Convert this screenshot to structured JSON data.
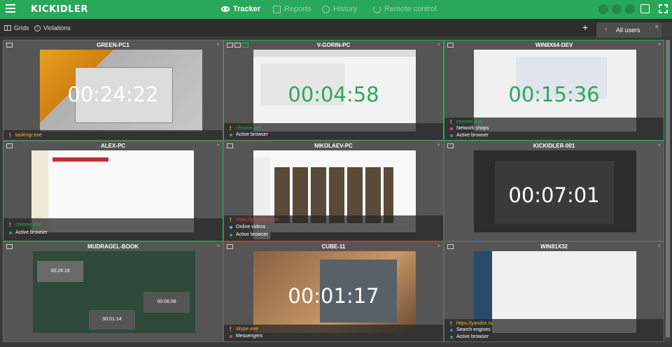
{
  "app": {
    "logo": "KICKIDLER"
  },
  "nav": [
    {
      "label": "Tracker",
      "active": true,
      "icon": "eye-icon"
    },
    {
      "label": "Reports",
      "active": false,
      "icon": "report-icon"
    },
    {
      "label": "History",
      "active": false,
      "icon": "history-icon"
    },
    {
      "label": "Remote control",
      "active": false,
      "icon": "remote-icon"
    }
  ],
  "subbar": {
    "grids": "Grids",
    "violations": "Violations",
    "add": "+",
    "user_tab": "All users",
    "close": "×"
  },
  "tiles": [
    {
      "name": "GREEN-PC1",
      "timer": "00:24:22",
      "timer_color": "white",
      "border": "none",
      "rows": [
        {
          "type": "excl",
          "text": "taskmgr.exe",
          "cls": "app-y"
        }
      ]
    },
    {
      "name": "V-GORIN-PC",
      "timer": "00:04:58",
      "timer_color": "green",
      "border": "green",
      "rows": [
        {
          "type": "excl",
          "text": "chrome.exe",
          "cls": "app-g"
        },
        {
          "type": "dot",
          "color": "#2aa85a",
          "text": "Active browser"
        }
      ]
    },
    {
      "name": "WIN8X64-DEV",
      "timer": "00:15:36",
      "timer_color": "green",
      "border": "green",
      "rows": [
        {
          "type": "excl",
          "text": "chrome.exe",
          "cls": "app-g"
        },
        {
          "type": "dot",
          "color": "#d04090",
          "text": "Network shops"
        },
        {
          "type": "dot",
          "color": "#2aa85a",
          "text": "Active browser"
        }
      ]
    },
    {
      "name": "ALEX-PC",
      "timer": "",
      "timer_color": "white",
      "border": "green",
      "rows": [
        {
          "type": "excl",
          "text": "chrome.exe",
          "cls": "app-g"
        },
        {
          "type": "dot",
          "color": "#2aa85a",
          "text": "Active browser"
        }
      ]
    },
    {
      "name": "NIKOLAEV-PC",
      "timer": "",
      "timer_color": "white",
      "border": "red",
      "rows": [
        {
          "type": "excl",
          "text": "https://youtube.com",
          "cls": "app-r"
        },
        {
          "type": "dot",
          "color": "#40c0e0",
          "text": "Online videos"
        },
        {
          "type": "dot",
          "color": "#2aa85a",
          "text": "Active browser"
        }
      ]
    },
    {
      "name": "KICKIDLER-001",
      "timer": "00:07:01",
      "timer_color": "white",
      "border": "none",
      "rows": []
    },
    {
      "name": "MUDRAGEL-BOOK",
      "timer": "",
      "timer_color": "white",
      "border": "none",
      "rows": []
    },
    {
      "name": "CUBE-11",
      "timer": "00:01:17",
      "timer_color": "white",
      "border": "none",
      "rows": [
        {
          "type": "excl",
          "text": "skype.exe",
          "cls": "app-y"
        },
        {
          "type": "dot",
          "color": "#d04090",
          "text": "Messengers"
        }
      ]
    },
    {
      "name": "WIN81X32",
      "timer": "",
      "timer_color": "white",
      "border": "none",
      "rows": [
        {
          "type": "excl",
          "text": "https://yandex.ru",
          "cls": "app-y"
        },
        {
          "type": "dot",
          "color": "#4080e0",
          "text": "Search engines"
        },
        {
          "type": "dot",
          "color": "#2aa85a",
          "text": "Active browser"
        }
      ]
    }
  ],
  "mudragel_subtimers": [
    "00:24:18",
    "00:06:58",
    "00:01:14"
  ],
  "colors": {
    "brand": "#2aa85a",
    "violation": "#b83a3a"
  }
}
